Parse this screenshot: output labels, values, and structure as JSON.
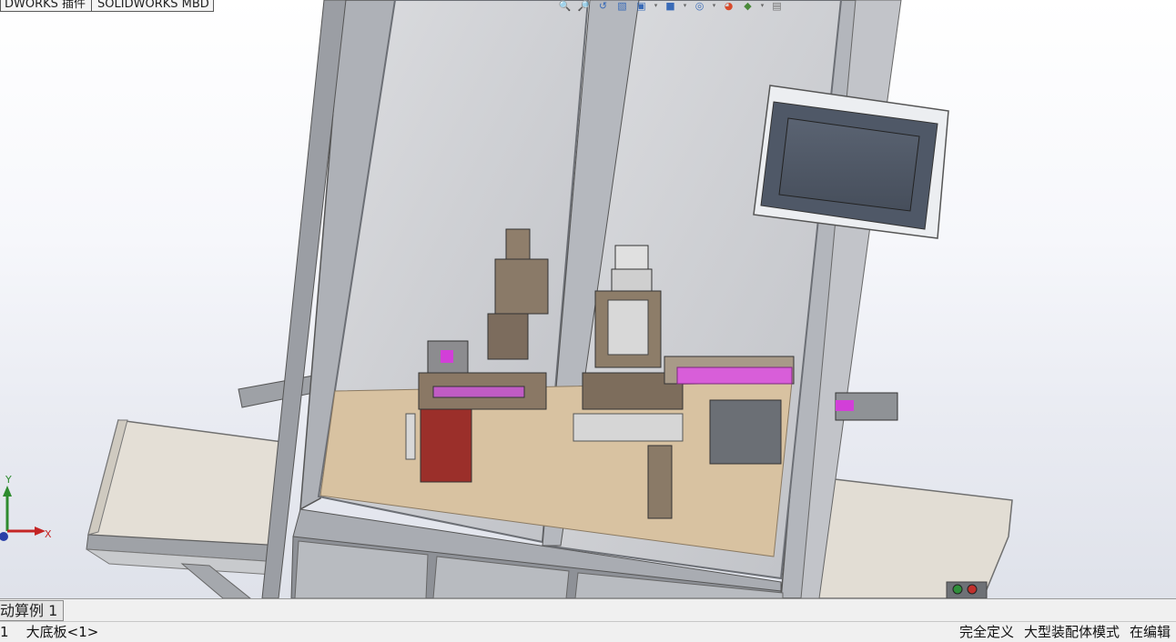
{
  "app": {
    "name": "SOLIDWORKS"
  },
  "top_tabs": [
    "DWORKS 插件",
    "SOLIDWORKS MBD"
  ],
  "heads_up_toolbar": {
    "icons": [
      "zoom-to-fit-icon",
      "zoom-area-icon",
      "previous-view-icon",
      "section-view-icon",
      "view-orientation-icon",
      "display-style-icon",
      "hide-show-items-icon",
      "edit-appearance-icon",
      "apply-scene-icon",
      "view-settings-icon"
    ]
  },
  "triad": {
    "y_label": "Y",
    "x_label": "X"
  },
  "bottom_tab": {
    "label": "动算例 1"
  },
  "status": {
    "left_index": "1",
    "selected_part": "大底板<1>",
    "definition": "完全定义",
    "mode": "大型装配体模式",
    "editing": "在编辑"
  },
  "colors": {
    "frame": "#b9bcc3",
    "glass": "#cfd0d3",
    "plate": "#d9c3a2",
    "screen": "#4e5766",
    "accent_magenta": "#d23fd8"
  }
}
